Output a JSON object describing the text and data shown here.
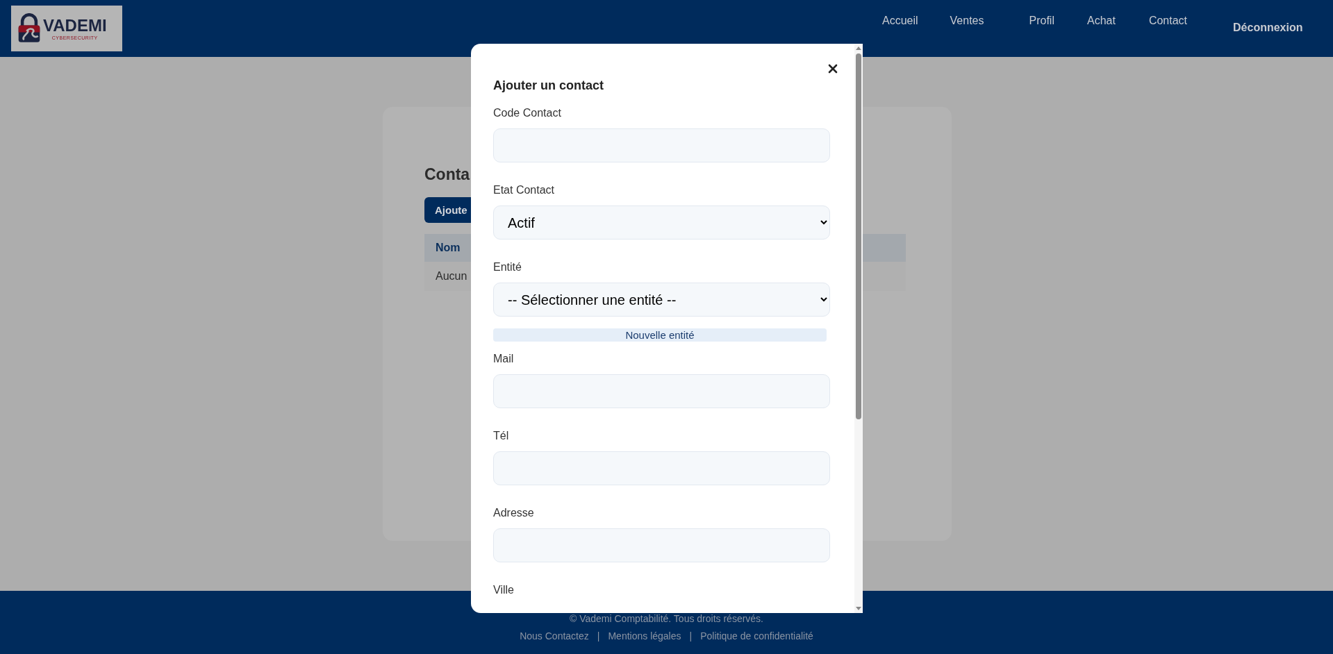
{
  "header": {
    "logo": {
      "name": "VADEMI",
      "tagline": "CYBERSECURITY"
    },
    "nav": [
      {
        "label": "Accueil"
      },
      {
        "label": "Ventes"
      },
      {
        "label": "Profil"
      },
      {
        "label": "Achat"
      },
      {
        "label": "Contact"
      }
    ],
    "logout": "Déconnexion"
  },
  "page": {
    "title": "Conta",
    "add_button": "Ajoute",
    "table": {
      "columns": [
        "Nom"
      ],
      "rows": [
        [
          "Aucun"
        ]
      ]
    }
  },
  "modal": {
    "title": "Ajouter un contact",
    "fields": [
      {
        "kind": "input",
        "label": "Code Contact"
      },
      {
        "kind": "select",
        "label": "Etat Contact",
        "value": "Actif"
      },
      {
        "kind": "select",
        "label": "Entité",
        "value": "-- Sélectionner une entité --"
      },
      {
        "kind": "button",
        "label": "Nouvelle entité"
      },
      {
        "kind": "input",
        "label": "Mail"
      },
      {
        "kind": "input",
        "label": "Tél"
      },
      {
        "kind": "input",
        "label": "Adresse"
      },
      {
        "kind": "label",
        "label": "Ville"
      }
    ]
  },
  "footer": {
    "copyright": "© Vademi Comptabilité. Tous droits réservés.",
    "links": [
      "Nous Contactez",
      "Mentions légales",
      "Politique de confidentialité"
    ],
    "separator": "|"
  }
}
